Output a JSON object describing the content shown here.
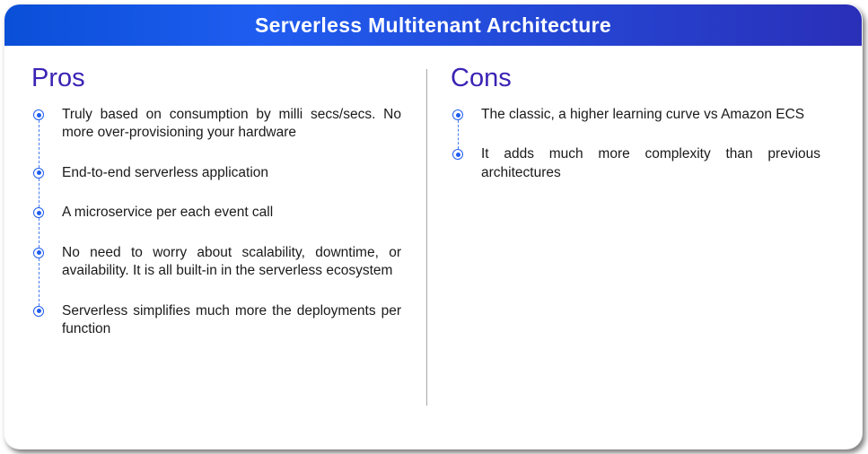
{
  "header": {
    "title": "Serverless Multitenant Architecture"
  },
  "pros": {
    "title": "Pros",
    "items": [
      "Truly based on consumption by milli secs/secs. No more over-provisioning your hardware",
      "End-to-end serverless application",
      "A microservice per each event call",
      "No need to worry about scalability, down­time, or availability. It is all built-in in the serverless ecosystem",
      "Serverless simplifies much more the de­ployments per function"
    ]
  },
  "cons": {
    "title": "Cons",
    "items": [
      "The classic, a higher learning curve vs Amazon ECS",
      "It adds much more complexity than pre­vious architectures"
    ]
  }
}
